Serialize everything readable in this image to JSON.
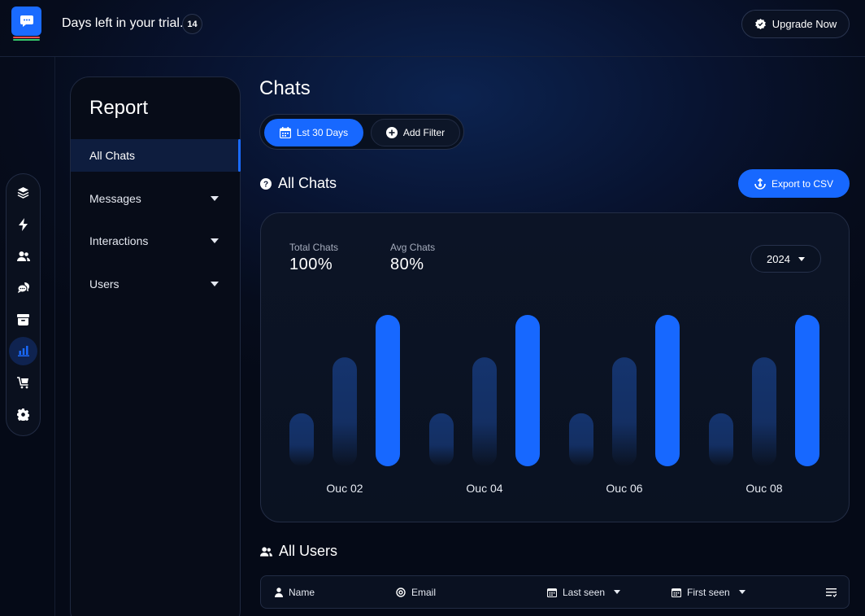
{
  "topbar": {
    "trial_text": "Days left in your trial.",
    "trial_days": "14",
    "upgrade_label": "Upgrade Now"
  },
  "rail": {
    "icons": [
      "layers-icon",
      "bolt-icon",
      "users-icon",
      "chat-bubbles-icon",
      "archive-icon",
      "bar-chart-icon",
      "cart-icon",
      "gear-icon"
    ],
    "active_index": 5
  },
  "sidebar": {
    "title": "Report",
    "items": [
      {
        "label": "All Chats",
        "active": true
      },
      {
        "label": "Messages",
        "expandable": true
      },
      {
        "label": "Interactions",
        "expandable": true
      },
      {
        "label": "Users",
        "expandable": true
      }
    ]
  },
  "main": {
    "title": "Chats",
    "filters": {
      "date_range_label": "Lst 30 Days",
      "add_filter_label": "Add Filter"
    },
    "all_chats": {
      "heading": "All Chats",
      "export_label": "Export to CSV",
      "stats": [
        {
          "label": "Total Chats",
          "value": "100%"
        },
        {
          "label": "Avg Chats",
          "value": "80%"
        }
      ],
      "year": "2024"
    },
    "all_users": {
      "heading": "All Users",
      "columns": [
        {
          "label": "Name",
          "icon": "person-icon"
        },
        {
          "label": "Email",
          "icon": "at-icon"
        },
        {
          "label": "Last seen",
          "icon": "calendar-icon",
          "sortable": true
        },
        {
          "label": "First seen",
          "icon": "calendar-icon",
          "sortable": true
        }
      ]
    }
  },
  "colors": {
    "accent": "#1768ff",
    "bar_dim": "#15346e",
    "background": "#060c1c"
  },
  "chart_data": {
    "type": "bar",
    "categories": [
      "Ouc 02",
      "Ouc 04",
      "Ouc 06",
      "Ouc 08"
    ],
    "series": [
      {
        "values": [
          35,
          35,
          35,
          35
        ]
      },
      {
        "values": [
          72,
          72,
          72,
          72
        ]
      },
      {
        "values": [
          100,
          100,
          100,
          100
        ]
      }
    ],
    "ylim": [
      0,
      100
    ],
    "grid": false,
    "highlight_series": 2
  }
}
